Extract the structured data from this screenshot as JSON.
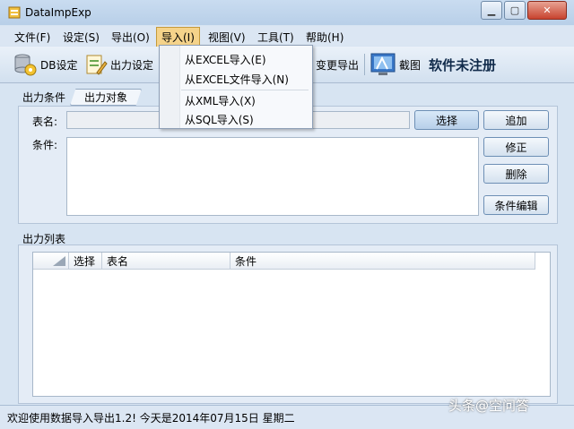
{
  "window": {
    "title": "DataImpExp"
  },
  "menubar": {
    "items": [
      "文件(F)",
      "设定(S)",
      "导出(O)",
      "导入(I)",
      "视图(V)",
      "工具(T)",
      "帮助(H)"
    ],
    "active_index": 3
  },
  "toolbar": {
    "db_label": "DB设定",
    "output_label": "出力设定",
    "change_export_label": "变更导出",
    "screenshot_label": "截图",
    "registration_status": "软件未注册"
  },
  "import_menu": {
    "items": [
      "从EXCEL导入(E)",
      "从EXCEL文件导入(N)",
      "从XML导入(X)",
      "从SQL导入(S)"
    ]
  },
  "output_condition": {
    "group_label": "出力条件",
    "tab_label": "出力对象",
    "table_name_label": "表名:",
    "table_name_value": "",
    "condition_label": "条件:",
    "condition_value": "",
    "buttons": {
      "select": "选择",
      "add": "追加",
      "modify": "修正",
      "delete": "删除",
      "edit_condition": "条件编辑"
    }
  },
  "output_list": {
    "group_label": "出力列表",
    "columns": [
      "选择",
      "表名",
      "条件"
    ],
    "rows": []
  },
  "statusbar": {
    "text": "欢迎使用数据导入导出1.2! 今天是2014年07月15日   星期二"
  },
  "watermark": {
    "text": "头条@空问答"
  }
}
